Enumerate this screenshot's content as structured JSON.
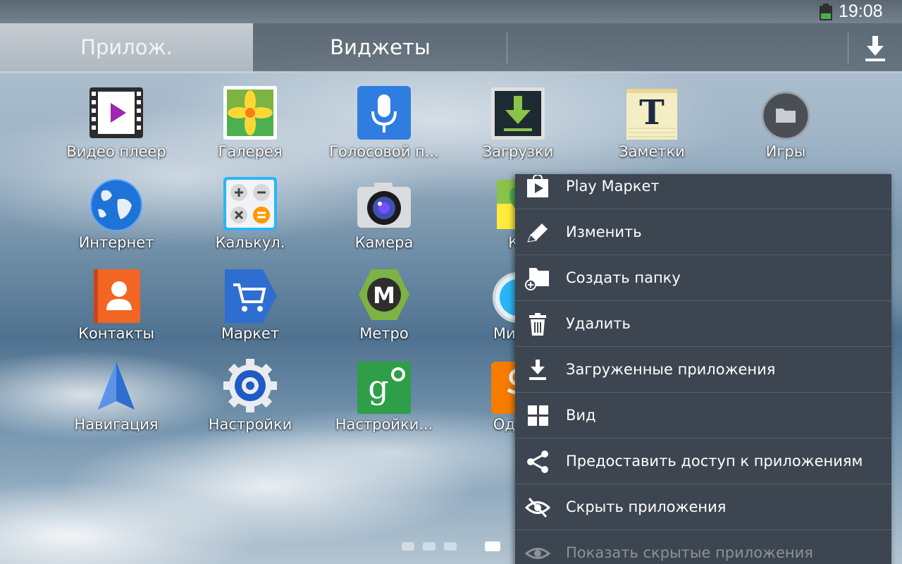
{
  "status_bar": {
    "time": "19:08"
  },
  "tabs": [
    {
      "label": "Прилож.",
      "selected": true
    },
    {
      "label": "Виджеты",
      "selected": false
    }
  ],
  "apps": [
    {
      "label": "Видео плеер",
      "icon": "video-player-icon"
    },
    {
      "label": "Галерея",
      "icon": "gallery-icon"
    },
    {
      "label": "Голосовой п...",
      "icon": "voice-search-icon"
    },
    {
      "label": "Загрузки",
      "icon": "downloads-icon"
    },
    {
      "label": "Заметки",
      "icon": "notes-icon"
    },
    {
      "label": "Игры",
      "icon": "games-folder-icon"
    },
    {
      "label": "Интернет",
      "icon": "internet-globe-icon"
    },
    {
      "label": "Калькул.",
      "icon": "calculator-icon"
    },
    {
      "label": "Камера",
      "icon": "camera-icon"
    },
    {
      "label": "Ка",
      "icon": "maps-icon"
    },
    {
      "label": "Контакты",
      "icon": "contacts-icon"
    },
    {
      "label": "Маркет",
      "icon": "market-cart-icon"
    },
    {
      "label": "Метро",
      "icon": "metro-icon"
    },
    {
      "label": "Миров",
      "icon": "world-clock-icon"
    },
    {
      "label": "Навигация",
      "icon": "navigation-arrow-icon"
    },
    {
      "label": "Настройки",
      "icon": "settings-gear-icon"
    },
    {
      "label": "Настройки...",
      "icon": "google-settings-icon"
    },
    {
      "label": "Однок",
      "icon": "odnoklassniki-icon"
    }
  ],
  "menu": {
    "items": [
      {
        "label": "Play Маркет",
        "icon": "play-store-icon",
        "enabled": true
      },
      {
        "label": "Изменить",
        "icon": "pencil-icon",
        "enabled": true
      },
      {
        "label": "Создать папку",
        "icon": "create-folder-icon",
        "enabled": true
      },
      {
        "label": "Удалить",
        "icon": "trash-icon",
        "enabled": true
      },
      {
        "label": "Загруженные приложения",
        "icon": "download-icon",
        "enabled": true
      },
      {
        "label": "Вид",
        "icon": "grid-view-icon",
        "enabled": true
      },
      {
        "label": "Предоставить доступ к приложениям",
        "icon": "share-icon",
        "enabled": true
      },
      {
        "label": "Скрыть приложения",
        "icon": "hide-eye-icon",
        "enabled": true
      },
      {
        "label": "Показать скрытые приложения",
        "icon": "show-eye-icon",
        "enabled": false
      }
    ]
  },
  "pager": {
    "pages": 4,
    "current": 4
  },
  "colors": {
    "menu_bg": "#3d4550",
    "menu_divider": "#59616b",
    "tab_selected": "#b9c1c8",
    "battery_green": "#4caf50"
  }
}
